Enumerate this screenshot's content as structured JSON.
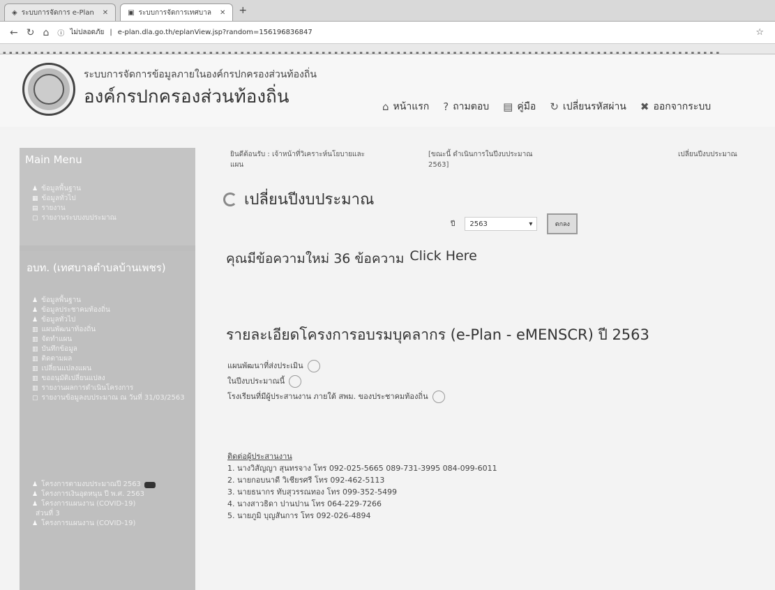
{
  "browser": {
    "tabs": [
      {
        "title": "ระบบการจัดการ e-Plan",
        "active": false
      },
      {
        "title": "ระบบการจัดการเทศบาล",
        "active": true
      }
    ],
    "url": "e-plan.dla.go.th/eplanView.jsp?random=156196836847",
    "url_prefix": "ไม่ปลอดภัย"
  },
  "header": {
    "small_title": "ระบบการจัดการข้อมูลภายในองค์กรปกครองส่วนท้องถิ่น",
    "big_title": "องค์กรปกครองส่วนท้องถิ่น",
    "nav": [
      {
        "icon": "home-icon",
        "glyph": "⌂",
        "label": "หน้าแรก"
      },
      {
        "icon": "question-icon",
        "glyph": "?",
        "label": "ถามตอบ"
      },
      {
        "icon": "manual-icon",
        "glyph": "▤",
        "label": "คู่มือ"
      },
      {
        "icon": "refresh-icon",
        "glyph": "↻",
        "label": "เปลี่ยนรหัสผ่าน"
      },
      {
        "icon": "close-icon",
        "glyph": "✖",
        "label": "ออกจากระบบ"
      }
    ]
  },
  "sidebar": {
    "main_menu_title": "Main Menu",
    "main_menu": [
      "ข้อมูลพื้นฐาน",
      "ข้อมูลทั่วไป",
      "รายงาน",
      "รายงานระบบงบประมาณ"
    ],
    "org_title": "อบท. (เทศบาลตำบลบ้านเพชร)",
    "org_menu": [
      "ข้อมูลพื้นฐาน",
      "ข้อมูลประชาคมท้องถิ่น",
      "ข้อมูลทั่วไป",
      "แผนพัฒนาท้องถิ่น",
      "จัดทำแผน",
      "บันทึกข้อมูล",
      "ติดตามผล",
      "เปลี่ยนแปลงแผน",
      "ขออนุมัติเปลี่ยนแปลง",
      "รายงานผลการดำเนินโครงการ",
      "รายงานข้อมูลงบประมาณ ณ วันที่ 31/03/2563"
    ],
    "covid_menu": [
      "โครงการตามงบประมาณปี 2563",
      "โครงการเงินอุดหนุน ปี พ.ศ. 2563",
      "โครงการแผนงาน (COVID-19)",
      "ส่วนที่ 3",
      "โครงการแผนงาน (COVID-19)"
    ]
  },
  "main": {
    "status_user": "ยินดีต้อนรับ : เจ้าหน้าที่วิเคราะห์นโยบายและแผน",
    "status_year": "[ขณะนี้ ดำเนินการในปีงบประมาณ 2563]",
    "status_change": "เปลี่ยนปีงบประมาณ",
    "page_heading": "เปลี่ยนปีงบประมาณ",
    "year_label": "ปี",
    "year_value": "2563",
    "go_label": "ตกลง",
    "message_text": "คุณมีข้อความใหม่ 36 ข้อความ",
    "message_link": "Click Here",
    "detail_title": "รายละเอียดโครงการอบรมบุคลากร (e-Plan - eMENSCR) ปี 2563",
    "approvals": [
      "แผนพัฒนาที่ส่งประเมิน",
      "ในปีงบประมาณนี้",
      "โรงเรียนที่มีผู้ประสานงาน ภายใต้ สพม. ของประชาคมท้องถิ่น"
    ],
    "contacts_title": "ติดต่อผู้ประสานงาน",
    "contacts": [
      "1. นางวิสัญญา สุนทรจาง โทร 092-025-5665 089-731-3995 084-099-6011",
      "2. นายกอบนาดี วิเชียรศรี โทร 092-462-5113",
      "3. นายธนากร ทับสุวรรณทอง โทร 099-352-5499",
      "4. นางสาวธิดา ปานปาน โทร 064-229-7266",
      "5. นายภูมิ บุญสันการ โทร 092-026-4894"
    ]
  }
}
